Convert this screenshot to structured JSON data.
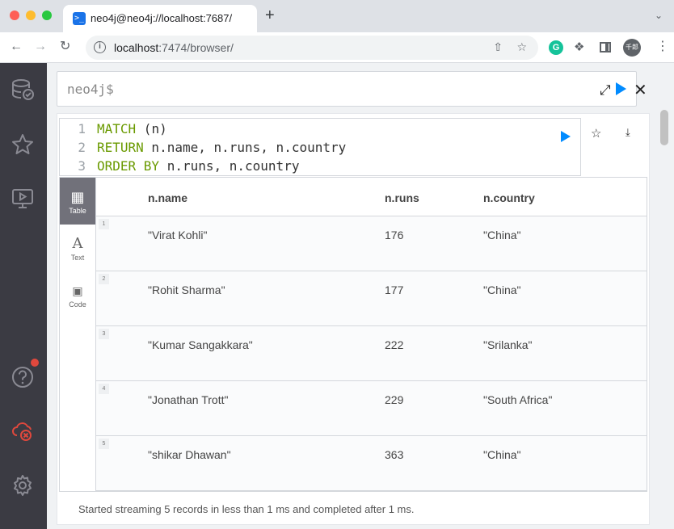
{
  "browser": {
    "tab_title": "neo4j@neo4j://localhost:7687/",
    "url_host": "localhost",
    "url_rest": ":7474/browser/",
    "profile_label": "千郎"
  },
  "editor": {
    "prompt": "neo4j$"
  },
  "query": {
    "lines": [
      {
        "num": "1",
        "kw": "MATCH",
        "rest": " (n)"
      },
      {
        "num": "2",
        "kw": "RETURN",
        "rest": " n.name, n.runs, n.country"
      },
      {
        "num": "3",
        "kw": "ORDER BY",
        "rest": " n.runs, n.country"
      }
    ]
  },
  "view_tabs": [
    {
      "label": "Table",
      "icon": "table-icon"
    },
    {
      "label": "Text",
      "icon": "text-icon"
    },
    {
      "label": "Code",
      "icon": "code-icon"
    }
  ],
  "table": {
    "headers": [
      "n.name",
      "n.runs",
      "n.country"
    ],
    "rows": [
      {
        "num": "1",
        "name": "\"Virat Kohli\"",
        "runs": "176",
        "country": "\"China\""
      },
      {
        "num": "2",
        "name": "\"Rohit Sharma\"",
        "runs": "177",
        "country": "\"China\""
      },
      {
        "num": "3",
        "name": "\"Kumar Sangakkara\"",
        "runs": "222",
        "country": "\"Srilanka\""
      },
      {
        "num": "4",
        "name": "\"Jonathan Trott\"",
        "runs": "229",
        "country": "\"South Africa\""
      },
      {
        "num": "5",
        "name": "\"shikar Dhawan\"",
        "runs": "363",
        "country": "\"China\""
      }
    ]
  },
  "status": "Started streaming 5 records in less than 1 ms and completed after 1 ms.",
  "colors": {
    "accent": "#018bff",
    "keyword": "#6a9a00",
    "sidebar": "#3b3b43",
    "notification": "#e0483d"
  }
}
